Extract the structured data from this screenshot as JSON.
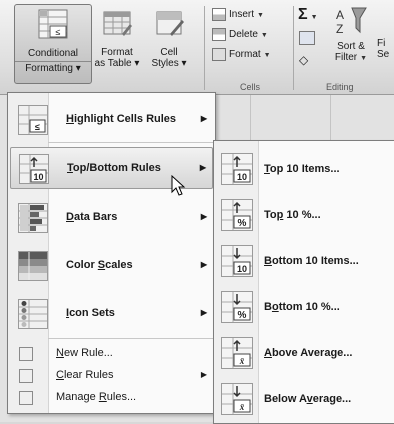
{
  "ribbon": {
    "conditional_formatting": {
      "line1": "Conditional",
      "line2": "Formatting",
      "arrow": "▾"
    },
    "format_table": {
      "line1": "Format",
      "line2": "as Table",
      "arrow": "▾"
    },
    "cell_styles": {
      "line1": "Cell",
      "line2": "Styles",
      "arrow": "▾"
    },
    "cells_group": {
      "insert": "Insert",
      "delete": "Delete",
      "format": "Format",
      "label": "Cells"
    },
    "editing_group": {
      "sigma": "Σ",
      "sort_filter_line1": "Sort &",
      "sort_filter_line2": "Filter",
      "find_line1": "Fi",
      "find_line2": "Se",
      "label": "Editing"
    }
  },
  "main_menu": {
    "items": [
      {
        "label": "Highlight Cells Rules",
        "accel": "H",
        "rest": "ighlight Cells Rules",
        "icon": "highlight-cells-rules-icon",
        "has_submenu": true
      },
      {
        "label": "Top/Bottom Rules",
        "accel": "T",
        "rest": "op/Bottom Rules",
        "icon": "top-bottom-rules-icon",
        "has_submenu": true
      },
      {
        "label": "Data Bars",
        "accel": "D",
        "rest": "ata Bars",
        "icon": "data-bars-icon",
        "has_submenu": true
      },
      {
        "label": "Color Scales",
        "pre": "Color ",
        "accel": "S",
        "rest": "cales",
        "icon": "color-scales-icon",
        "has_submenu": true
      },
      {
        "label": "Icon Sets",
        "accel": "I",
        "rest": "con Sets",
        "icon": "icon-sets-icon",
        "has_submenu": true
      }
    ],
    "small_items": [
      {
        "label": "New Rule...",
        "accel": "N",
        "rest": "ew Rule...",
        "icon": "new-rule-icon",
        "has_submenu": false
      },
      {
        "label": "Clear Rules",
        "accel": "C",
        "rest": "lear Rules",
        "icon": "clear-rules-icon",
        "has_submenu": true
      },
      {
        "label": "Manage Rules...",
        "pre": "Manage ",
        "accel": "R",
        "rest": "ules...",
        "icon": "manage-rules-icon",
        "has_submenu": false
      }
    ],
    "submenu_arrow": "▶"
  },
  "sub_menu": {
    "items": [
      {
        "label": "Top 10 Items...",
        "accel": "T",
        "rest": "op 10 Items...",
        "icon": "top-10-items-icon"
      },
      {
        "label": "Top 10 %...",
        "pre": "To",
        "accel": "p",
        "rest": " 10 %...",
        "icon": "top-10-percent-icon"
      },
      {
        "label": "Bottom 10 Items...",
        "accel": "B",
        "rest": "ottom 10 Items...",
        "icon": "bottom-10-items-icon"
      },
      {
        "label": "Bottom 10 %...",
        "pre": "B",
        "accel": "o",
        "rest": "ttom 10 %...",
        "icon": "bottom-10-percent-icon"
      },
      {
        "label": "Above Average...",
        "accel": "A",
        "rest": "bove Average...",
        "icon": "above-average-icon"
      },
      {
        "label": "Below Average...",
        "pre": "Below A",
        "accel": "v",
        "rest": "erage...",
        "icon": "below-average-icon"
      }
    ]
  },
  "icon_glyphs": {
    "ten": "10",
    "percent": "%",
    "less": "≤",
    "xbar": "x̄"
  },
  "colors": {
    "hover_bg": "#d6d6d6",
    "menu_bg": "#fafafa",
    "accent_red": "#c03030",
    "accent_blue": "#5070a0"
  }
}
